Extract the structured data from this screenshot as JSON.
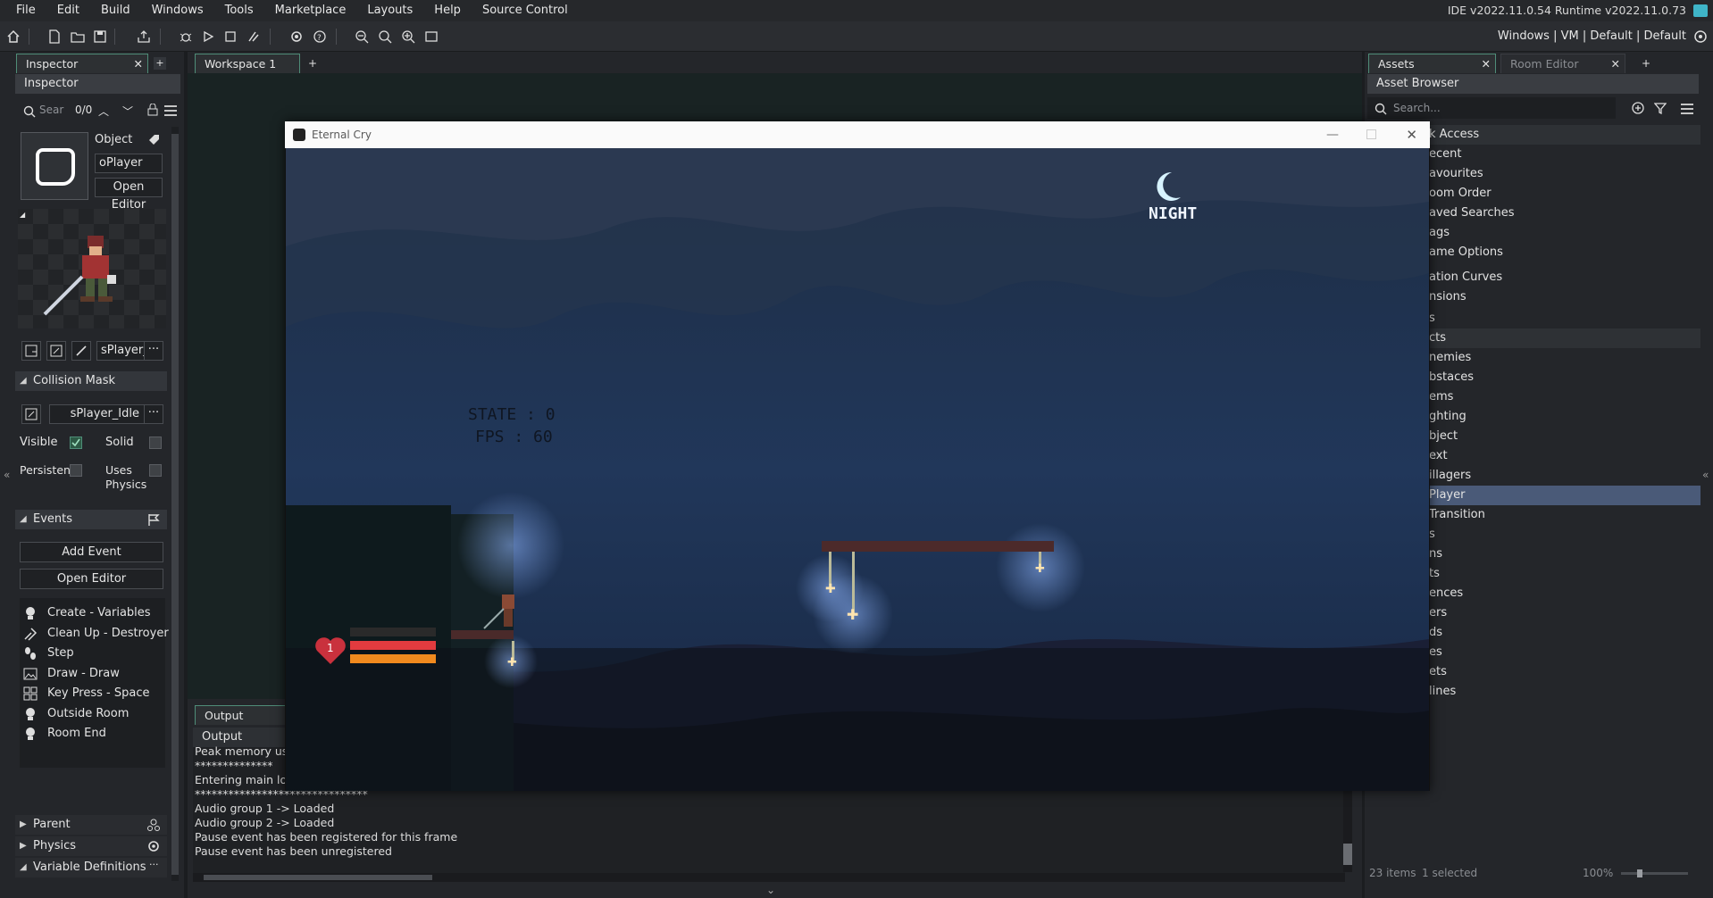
{
  "menu": [
    "File",
    "Edit",
    "Build",
    "Windows",
    "Tools",
    "Marketplace",
    "Layouts",
    "Help",
    "Source Control"
  ],
  "ide_version": "IDE v2022.11.0.54  Runtime v2022.11.0.73",
  "toolbar_right": "Windows  |  VM  |  Default  |  Default",
  "inspector": {
    "tab": "Inspector",
    "header": "Inspector",
    "search_placeholder": "Sear",
    "search_count": "0/0",
    "object_label": "Object",
    "object_name": "oPlayer",
    "open_editor": "Open Editor",
    "sprite_name": "sPlayer_",
    "collision_mask": "Collision Mask",
    "mask_sprite": "sPlayer_Idle",
    "visible": "Visible",
    "solid": "Solid",
    "persistent": "Persisten",
    "uses_physics": "Uses Physics",
    "events_title": "Events",
    "add_event": "Add Event",
    "open_editor_2": "Open Editor",
    "events": [
      {
        "label": "Create - Variables",
        "icon": "lightbulb-icon"
      },
      {
        "label": "Clean Up - Destroyer",
        "icon": "broom-icon"
      },
      {
        "label": "Step",
        "icon": "footsteps-icon"
      },
      {
        "label": "Draw - Draw",
        "icon": "picture-icon"
      },
      {
        "label": "Key Press - Space",
        "icon": "keyboard-icon"
      },
      {
        "label": "Outside Room",
        "icon": "lightbulb-icon"
      },
      {
        "label": "Room End",
        "icon": "lightbulb-icon"
      }
    ],
    "parent": "Parent",
    "physics": "Physics",
    "variable_definitions": "Variable Definitions"
  },
  "workspace": {
    "tab": "Workspace 1"
  },
  "assets": {
    "tab": "Assets",
    "room_editor_tab": "Room Editor",
    "header": "Asset Browser",
    "search_placeholder": "Search...",
    "rows": [
      "k Access",
      "ecent",
      "avourites",
      "oom Order",
      "aved Searches",
      "ags",
      "ame Options",
      "ation Curves",
      "nsions",
      "s",
      "cts",
      "nemies",
      "bstaces",
      "ems",
      "ghting",
      "bject",
      "ext",
      "illagers",
      "Player",
      "Transition",
      "s",
      "ns",
      "ts",
      "ences",
      "ers",
      "ds",
      "es",
      "ets",
      "lines"
    ],
    "selected_row": "Player",
    "status_items": "23 items",
    "status_selected": "1 selected",
    "zoom": "100%"
  },
  "game": {
    "title": "Eternal Cry",
    "night_label": "NIGHT",
    "state_text": "STATE : 0",
    "fps_text": "FPS : 60",
    "lives": "1",
    "health_fraction": 1.0,
    "stamina_fraction": 1.0
  },
  "output": {
    "tab": "Output",
    "header": "Output",
    "lines": [
      "Peak memory used",
      "**************",
      "Entering main loop.",
      "*******************************",
      "Audio group 1 -> Loaded",
      "Audio group 2 -> Loaded",
      "Pause event has been registered for this frame",
      "Pause event has been unregistered"
    ]
  }
}
